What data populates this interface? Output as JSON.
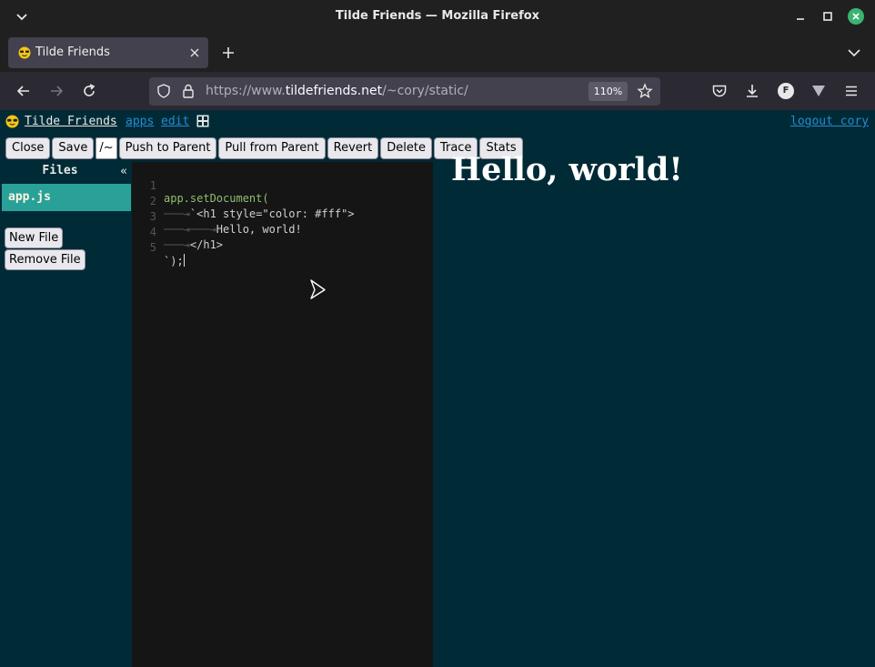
{
  "window": {
    "title": "Tilde Friends — Mozilla Firefox"
  },
  "tabs": [
    {
      "label": "Tilde Friends",
      "favicon": "sunglasses-emoji-icon"
    }
  ],
  "urlbar": {
    "url_prefix": "https://www.",
    "url_domain": "tildefriends.net",
    "url_path": "/~cory/static/",
    "zoom": "110%"
  },
  "app_header": {
    "brand": "Tilde Friends",
    "links": [
      "apps",
      "edit"
    ],
    "logout": "logout cory"
  },
  "toolbar": {
    "buttons": [
      "Close",
      "Save",
      "/~",
      "Push to Parent",
      "Pull from Parent",
      "Revert",
      "Delete",
      "Trace",
      "Stats"
    ]
  },
  "files": {
    "header": "Files",
    "collapse": "«",
    "items": [
      "app.js"
    ],
    "new_file": "New File",
    "remove_file": "Remove File"
  },
  "editor": {
    "lines": [
      {
        "num": "1",
        "indent": "",
        "code": "app.setDocument("
      },
      {
        "num": "2",
        "indent": "───⇥",
        "code": "`<h1 style=\"color: #fff\">"
      },
      {
        "num": "3",
        "indent": "───⇥───⇥",
        "code": "Hello, world!"
      },
      {
        "num": "4",
        "indent": "───⇥",
        "code": "</h1>"
      },
      {
        "num": "5",
        "indent": "",
        "code": "`);"
      }
    ]
  },
  "preview": {
    "heading": "Hello, world!"
  },
  "colors": {
    "page_bg": "#002b36",
    "selected_file": "#2aa198",
    "link": "#268bd2",
    "editor_bg": "#151515"
  }
}
